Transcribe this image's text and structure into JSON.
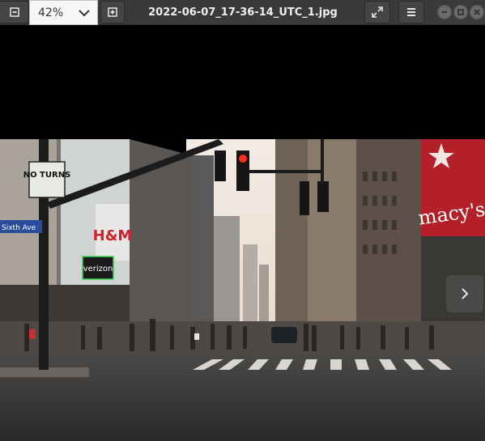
{
  "window": {
    "title": "2022-06-07_17-36-14_UTC_1.jpg"
  },
  "toolbar": {
    "zoom_value": "42%",
    "icons": {
      "zoom_out": "minus-icon",
      "zoom_dropdown": "chevron-down-icon",
      "zoom_in": "plus-icon",
      "fullscreen": "fullscreen-icon",
      "menu": "hamburger-menu-icon",
      "minimize": "minimize-icon",
      "maximize": "maximize-icon",
      "close": "close-icon"
    }
  },
  "photo": {
    "signs": {
      "no_turns": "NO TURNS",
      "street": "Sixth Ave",
      "hm": "H&M",
      "verizon": "verizon",
      "macys": "macy's"
    }
  },
  "colors": {
    "headerbar": "#3a3a39",
    "zoom_field": "#f6f6f5",
    "viewer_background": "#000000",
    "macys_red": "#b3202a",
    "traffic_light_red": "#ff2a1a"
  }
}
